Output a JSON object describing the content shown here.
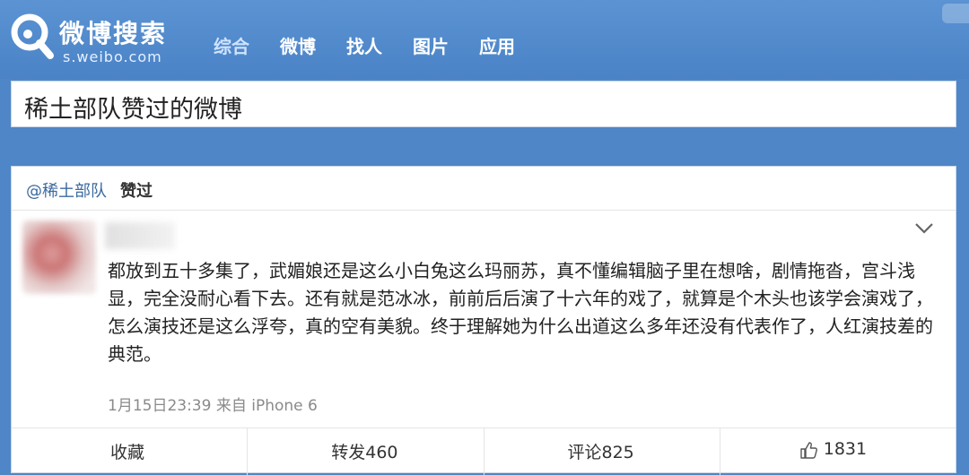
{
  "header": {
    "logo_text": "微博搜索",
    "logo_sub": "s.weibo.com",
    "nav": [
      {
        "label": "综合",
        "active": true
      },
      {
        "label": "微博",
        "active": false
      },
      {
        "label": "找人",
        "active": false
      },
      {
        "label": "图片",
        "active": false
      },
      {
        "label": "应用",
        "active": false
      }
    ]
  },
  "search": {
    "query": "稀土部队赞过的微博"
  },
  "card": {
    "liked_user": "@稀土部队",
    "liked_action": "赞过",
    "post_text": "都放到五十多集了，武媚娘还是这么小白兔这么玛丽苏，真不懂编辑脑子里在想啥，剧情拖沓，宫斗浅显，完全没耐心看下去。还有就是范冰冰，前前后后演了十六年的戏了，就算是个木头也该学会演戏了，怎么演技还是这么浮夸，真的空有美貌。终于理解她为什么出道这么多年还没有代表作了，人红演技差的典范。",
    "meta": "1月15日23:39 来自 iPhone 6",
    "actions": {
      "favorite": "收藏",
      "repost": "转发460",
      "comment": "评论825",
      "like": "1831"
    }
  },
  "colors": {
    "header_blue": "#4f86c7",
    "link_blue": "#3b6aa0",
    "meta_gray": "#8a8a8a"
  },
  "icons": [
    "weibo-search-logo-icon",
    "chevron-down-icon",
    "thumbs-up-icon"
  ]
}
